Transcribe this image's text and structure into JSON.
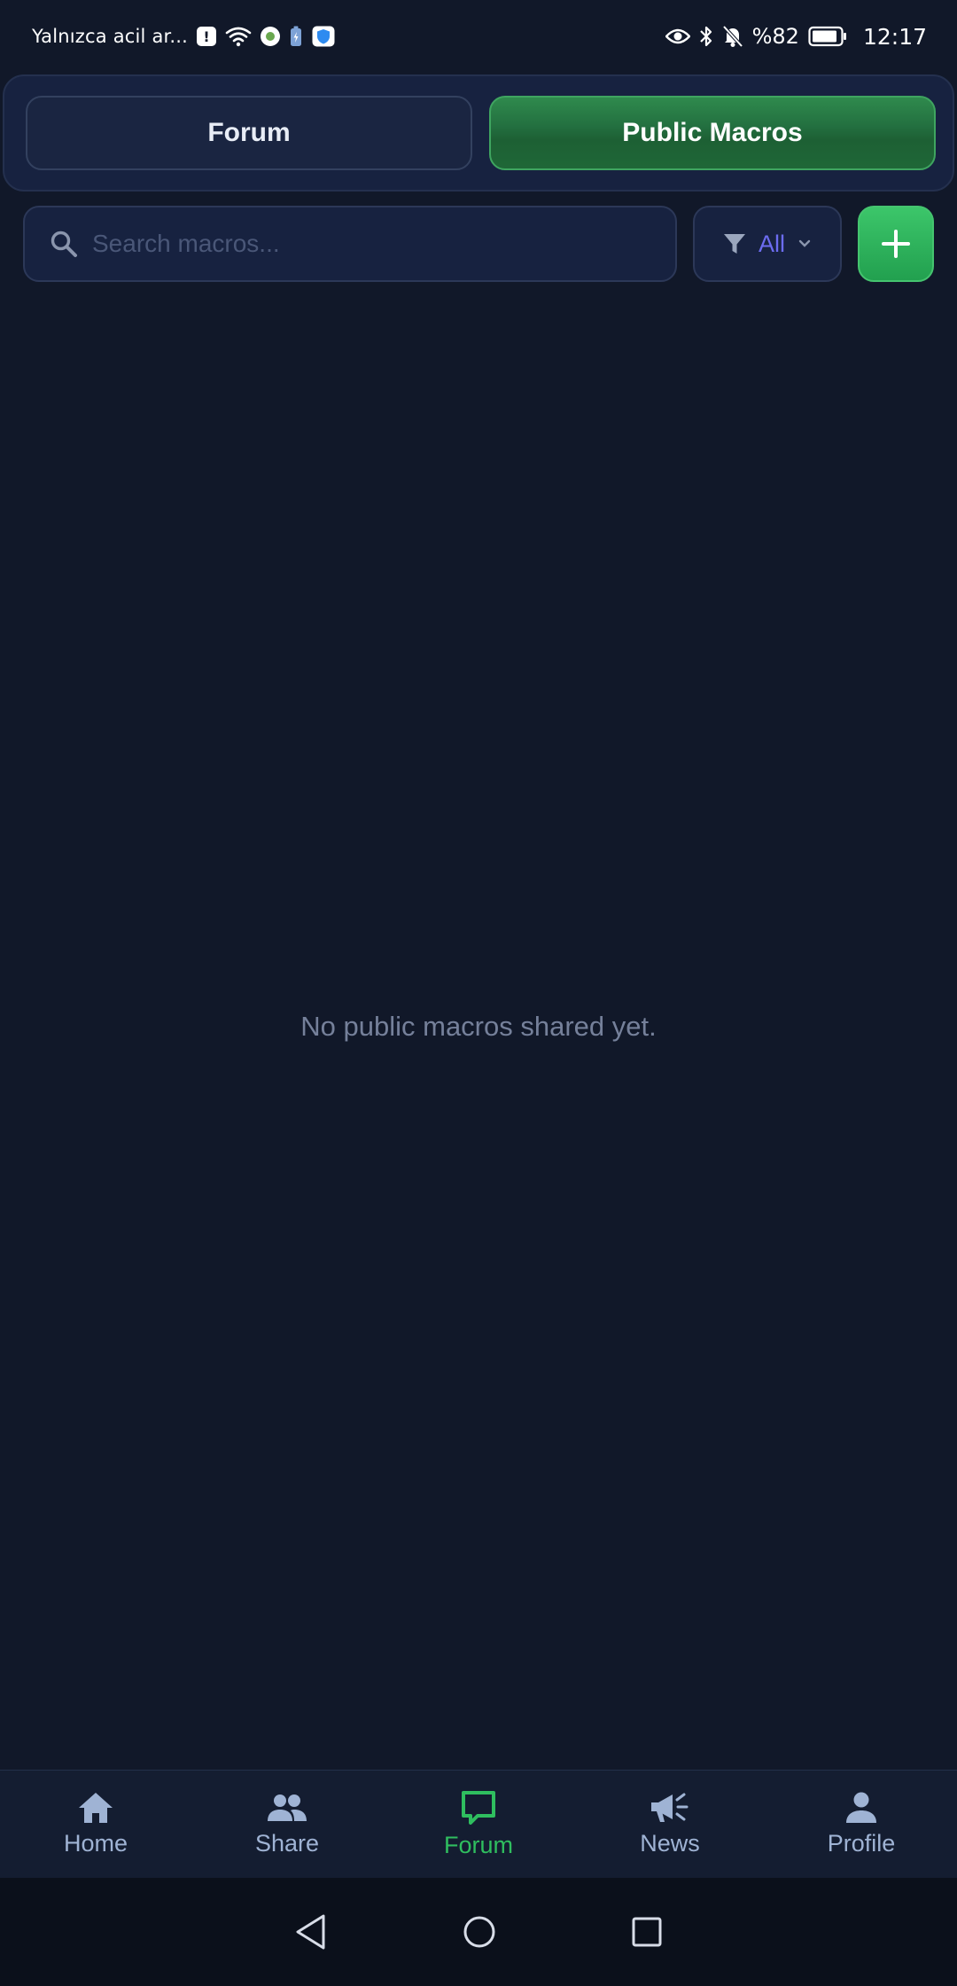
{
  "status_bar": {
    "carrier_text": "Yalnızca acil ar...",
    "battery_percent": "%82",
    "time": "12:17",
    "icons": [
      "alert-icon",
      "wifi-icon",
      "app-dot-icon",
      "battery-saver-icon",
      "shield-icon",
      "eye-icon",
      "bluetooth-icon",
      "bell-off-icon",
      "battery-icon"
    ]
  },
  "tabs": {
    "forum_label": "Forum",
    "public_macros_label": "Public Macros",
    "active": "public_macros"
  },
  "search": {
    "placeholder": "Search macros...",
    "value": ""
  },
  "filter": {
    "selected": "All"
  },
  "empty_state": {
    "message": "No public macros shared yet."
  },
  "bottom_nav": {
    "items": [
      {
        "label": "Home",
        "icon": "home-icon"
      },
      {
        "label": "Share",
        "icon": "people-icon"
      },
      {
        "label": "Forum",
        "icon": "chat-icon"
      },
      {
        "label": "News",
        "icon": "megaphone-icon"
      },
      {
        "label": "Profile",
        "icon": "person-icon"
      }
    ],
    "active_index": 2
  },
  "colors": {
    "background": "#111829",
    "accent_green": "#2fbe5f",
    "filter_text": "#6c6cf0",
    "nav_inactive": "#9fb3d4"
  }
}
